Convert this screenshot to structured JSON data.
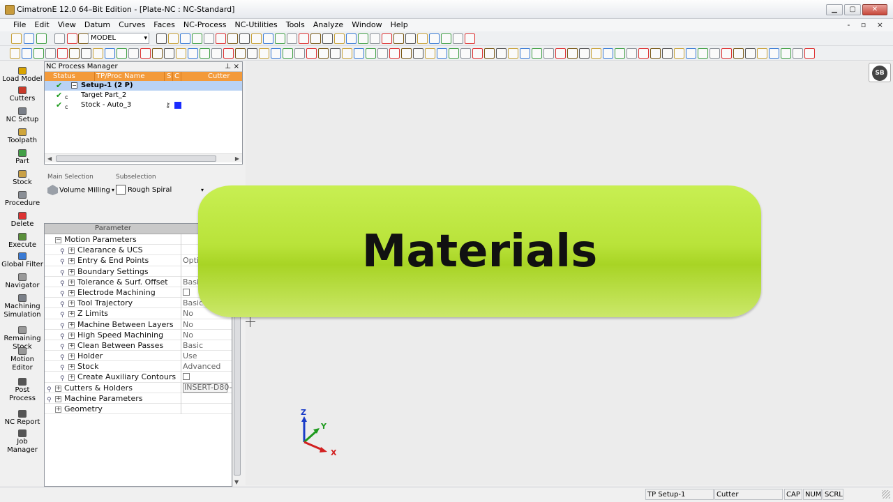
{
  "window": {
    "title": "CimatronE 12.0 64–Bit Edition - [Plate-NC : NC-Standard]",
    "btn_min": "▁",
    "btn_max": "▢",
    "btn_close": "✕"
  },
  "menu": {
    "items": [
      "File",
      "Edit",
      "View",
      "Datum",
      "Curves",
      "Faces",
      "NC-Process",
      "NC-Utilities",
      "Tools",
      "Analyze",
      "Window",
      "Help"
    ],
    "mdi_buttons": "- ▫ ×"
  },
  "toolbar": {
    "model_select": "MODEL"
  },
  "sidebar": {
    "items": [
      {
        "label": "Load Model",
        "icon": "load-model-icon",
        "color": "#d9a400"
      },
      {
        "label": "Cutters",
        "icon": "cutter-icon",
        "color": "#c83a2a"
      },
      {
        "label": "NC Setup",
        "icon": "nc-setup-icon",
        "color": "#7a7f88"
      },
      {
        "label": "Toolpath",
        "icon": "toolpath-icon",
        "color": "#cfa53b"
      },
      {
        "label": "Part",
        "icon": "part-icon",
        "color": "#43a047"
      },
      {
        "label": "Stock",
        "icon": "stock-icon",
        "color": "#c9a046"
      },
      {
        "label": "Procedure",
        "icon": "procedure-icon",
        "color": "#8a8f96"
      },
      {
        "label": "Delete",
        "icon": "delete-icon",
        "color": "#d33"
      },
      {
        "label": "Execute",
        "icon": "execute-icon",
        "color": "#5a8f3a"
      },
      {
        "label": "Global Filter",
        "icon": "filter-icon",
        "color": "#3a7bd5"
      },
      {
        "label": "Navigator",
        "icon": "navigator-icon",
        "color": "#999"
      },
      {
        "label": "Machining Simulation",
        "icon": "simulation-icon",
        "color": "#7a7f88"
      },
      {
        "label": "Remaining Stock",
        "icon": "remaining-stock-icon",
        "color": "#999"
      },
      {
        "label": "Motion Editor",
        "icon": "motion-editor-icon",
        "color": "#999"
      },
      {
        "label": "Post Process",
        "icon": "post-process-icon",
        "color": "#555"
      },
      {
        "label": "NC Report",
        "icon": "nc-report-icon",
        "color": "#555"
      },
      {
        "label": "Job Manager",
        "icon": "job-manager-icon",
        "color": "#555"
      }
    ]
  },
  "nc_process_manager": {
    "title": "NC Process Manager",
    "pin": "⊥",
    "close": "×",
    "columns": [
      "Status",
      "TP/Proc Name",
      "S",
      "C",
      "Cutter"
    ],
    "rows": [
      {
        "label": "Setup-1 (2 P)",
        "expander": "−",
        "selected": true
      },
      {
        "label": "Target Part_2",
        "status": "✔",
        "sub": "c"
      },
      {
        "label": "Stock - Auto_3",
        "status": "✔",
        "sub": "c",
        "color": "#1a2cff"
      }
    ],
    "scroll_left": "◀",
    "scroll_right": "▶"
  },
  "selection": {
    "main_caption": "Main Selection",
    "main_value": "Volume Milling",
    "sub_caption": "Subselection",
    "sub_value": "Rough Spiral"
  },
  "parameters": {
    "header": "Parameter",
    "rows": [
      {
        "name": "Motion Parameters",
        "kind": "top",
        "ex": "−",
        "value": ""
      },
      {
        "name": "Clearance & UCS",
        "ex": "+",
        "value": ""
      },
      {
        "name": "Entry & End Points",
        "ex": "+",
        "value": "Optin"
      },
      {
        "name": "Boundary Settings",
        "ex": "+",
        "value": ""
      },
      {
        "name": "Tolerance & Surf. Offset",
        "ex": "+",
        "value": "Basic"
      },
      {
        "name": "Electrode Machining",
        "ex": "+",
        "value": "",
        "checkbox": true
      },
      {
        "name": "Tool Trajectory",
        "ex": "+",
        "value": "Basic"
      },
      {
        "name": "Z Limits",
        "ex": "+",
        "value": "No"
      },
      {
        "name": "Machine Between Layers",
        "ex": "+",
        "value": "No"
      },
      {
        "name": "High Speed Machining",
        "ex": "+",
        "value": "No"
      },
      {
        "name": "Clean Between Passes",
        "ex": "+",
        "value": "Basic"
      },
      {
        "name": "Holder",
        "ex": "+",
        "value": "Use"
      },
      {
        "name": "Stock",
        "ex": "+",
        "value": "Advanced"
      },
      {
        "name": "Create Auxiliary Contours",
        "ex": "+",
        "value": "",
        "checkbox": true
      },
      {
        "name": "Cutters & Holders",
        "kind": "topl",
        "ex": "+",
        "value": "INSERT-D80-",
        "insert": true
      },
      {
        "name": "Machine Parameters",
        "kind": "topl",
        "ex": "+",
        "value": ""
      },
      {
        "name": "Geometry",
        "kind": "top",
        "ex": "+",
        "value": ""
      }
    ]
  },
  "viewport": {
    "logo": "SB",
    "banner_text": "Materials",
    "axis_z": "Z",
    "axis_y": "Y",
    "axis_x": "X"
  },
  "status": {
    "tp": "TP  Setup-1",
    "cutter": "Cutter",
    "cap": "CAP",
    "num": "NUM",
    "scrl": "SCRL"
  },
  "colors": {
    "accent_orange": "#f39a3a",
    "selection_blue": "#b9d2f4",
    "banner_green": "#b9e33a"
  }
}
